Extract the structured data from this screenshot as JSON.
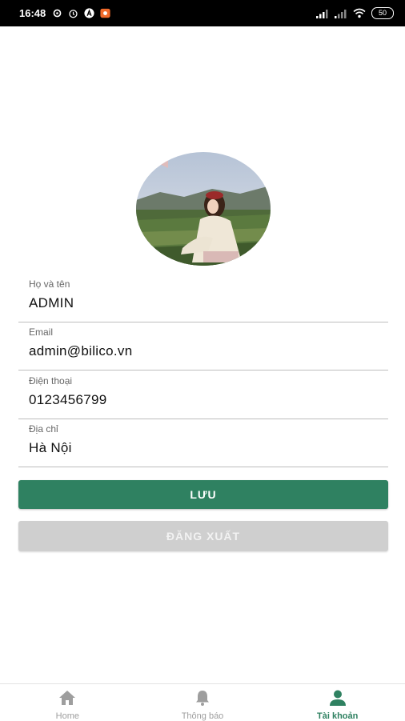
{
  "status_bar": {
    "time": "16:48",
    "battery": "50"
  },
  "profile": {
    "avatar_description": "profile photo"
  },
  "form": {
    "fields": [
      {
        "label": "Họ và tên",
        "value": "ADMIN"
      },
      {
        "label": "Email",
        "value": "admin@bilico.vn"
      },
      {
        "label": "Điện thoại",
        "value": "0123456799"
      },
      {
        "label": "Địa chỉ",
        "value": "Hà Nội"
      }
    ]
  },
  "buttons": {
    "save_label": "LƯU",
    "logout_label": "ĐĂNG XUẤT"
  },
  "tabs": [
    {
      "label": "Home",
      "icon": "home-icon",
      "active": false
    },
    {
      "label": "Thông báo",
      "icon": "bell-icon",
      "active": false
    },
    {
      "label": "Tài khoản",
      "icon": "user-icon",
      "active": true
    }
  ],
  "colors": {
    "accent": "#2f8161",
    "inactive_tab": "#9e9e9e",
    "disabled_button": "#cfcfcf"
  }
}
